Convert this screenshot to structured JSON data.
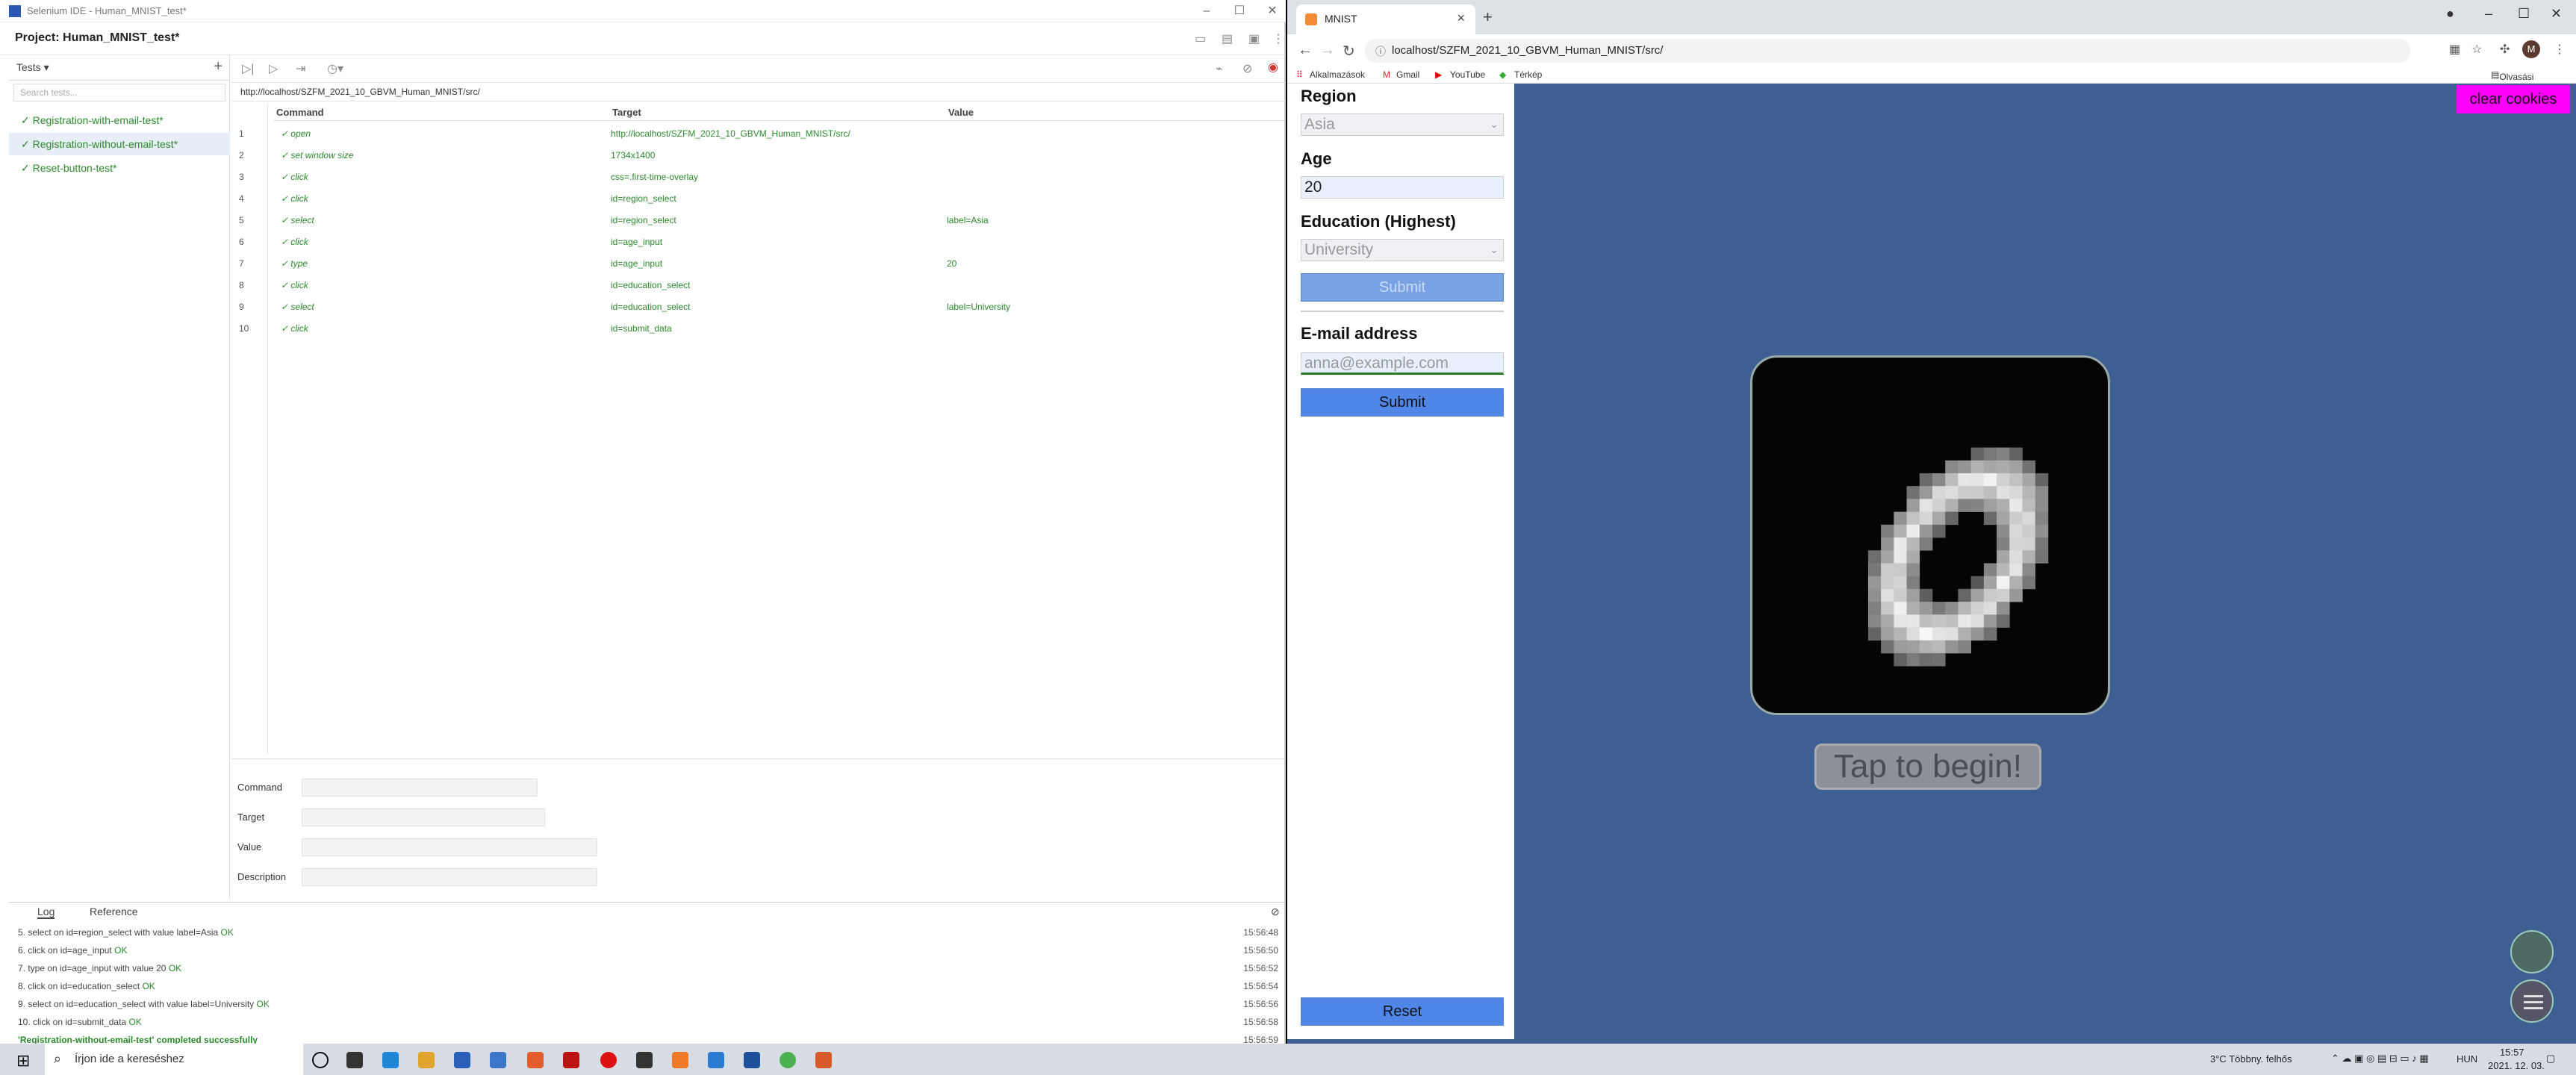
{
  "selenium": {
    "window_title": "Selenium IDE - Human_MNIST_test*",
    "project_label": "Project:  Human_MNIST_test*",
    "tests_header": "Tests",
    "search_placeholder": "Search tests...",
    "tests": [
      "Registration-with-email-test*",
      "Registration-without-email-test*",
      "Reset-button-test*"
    ],
    "url": "http://localhost/SZFM_2021_10_GBVM_Human_MNIST/src/",
    "columns": [
      "Command",
      "Target",
      "Value"
    ],
    "commands": [
      {
        "n": "1",
        "cmd": "open",
        "target": "http://localhost/SZFM_2021_10_GBVM_Human_MNIST/src/",
        "value": ""
      },
      {
        "n": "2",
        "cmd": "set window size",
        "target": "1734x1400",
        "value": ""
      },
      {
        "n": "3",
        "cmd": "click",
        "target": "css=.first-time-overlay",
        "value": ""
      },
      {
        "n": "4",
        "cmd": "click",
        "target": "id=region_select",
        "value": ""
      },
      {
        "n": "5",
        "cmd": "select",
        "target": "id=region_select",
        "value": "label=Asia"
      },
      {
        "n": "6",
        "cmd": "click",
        "target": "id=age_input",
        "value": ""
      },
      {
        "n": "7",
        "cmd": "type",
        "target": "id=age_input",
        "value": "20"
      },
      {
        "n": "8",
        "cmd": "click",
        "target": "id=education_select",
        "value": ""
      },
      {
        "n": "9",
        "cmd": "select",
        "target": "id=education_select",
        "value": "label=University"
      },
      {
        "n": "10",
        "cmd": "click",
        "target": "id=submit_data",
        "value": ""
      }
    ],
    "form_labels": {
      "command": "Command",
      "target": "Target",
      "value": "Value",
      "description": "Description"
    },
    "log_tabs": {
      "log": "Log",
      "reference": "Reference"
    },
    "log": [
      {
        "msg": "5.   select on id=region_select with value label=Asia",
        "status": "OK",
        "time": "15:56:48"
      },
      {
        "msg": "6.   click on id=age_input",
        "status": "OK",
        "time": "15:56:50"
      },
      {
        "msg": "7.   type on id=age_input with value 20",
        "status": "OK",
        "time": "15:56:52"
      },
      {
        "msg": "8.   click on id=education_select",
        "status": "OK",
        "time": "15:56:54"
      },
      {
        "msg": "9.   select on id=education_select with value label=University",
        "status": "OK",
        "time": "15:56:56"
      },
      {
        "msg": "10.  click on id=submit_data",
        "status": "OK",
        "time": "15:56:58"
      },
      {
        "msg": "'Registration-without-email-test' completed successfully",
        "status": "",
        "time": "15:56:59"
      }
    ]
  },
  "chrome": {
    "tab_title": "MNIST",
    "address": "localhost/SZFM_2021_10_GBVM_Human_MNIST/src/",
    "bookmarks": [
      "Alkalmazások",
      "Gmail",
      "YouTube",
      "Térkép"
    ],
    "reading_list": "Olvasási lista",
    "profile_initial": "M"
  },
  "mnist_page": {
    "region_label": "Region",
    "region_value": "Asia",
    "age_label": "Age",
    "age_value": "20",
    "education_label": "Education (Highest)",
    "education_value": "University",
    "submit_label": "Submit",
    "email_label": "E-mail address",
    "email_placeholder": "anna@example.com",
    "submit2_label": "Submit",
    "reset_label": "Reset",
    "clear_cookies": "clear cookies",
    "tap_to_begin": "Tap to begin!"
  },
  "taskbar": {
    "search_placeholder": "Írjon ide a kereséshez",
    "weather": "3°C  Többny. felhős",
    "language": "HUN",
    "time": "15:57",
    "date": "2021. 12. 03."
  }
}
